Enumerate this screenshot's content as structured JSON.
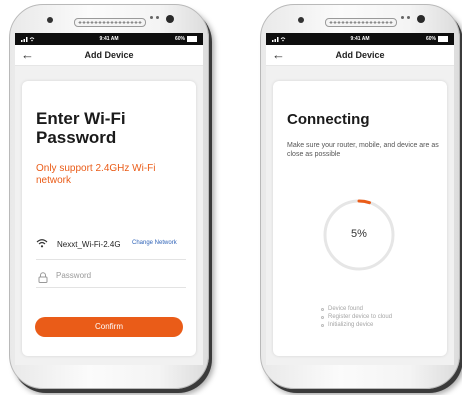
{
  "colors": {
    "accent": "#ea5c18",
    "link": "#2f63b8"
  },
  "status_bar": {
    "time": "9:41 AM",
    "battery": "60%"
  },
  "screen1": {
    "nav_title": "Add Device",
    "heading": "Enter Wi-Fi Password",
    "warning": "Only support 2.4GHz Wi-Fi network",
    "ssid": "Nexxt_Wi-Fi-2.4G",
    "change_network": "Change Network",
    "password_placeholder": "Password",
    "confirm_label": "Confirm",
    "icons": [
      "back-arrow-icon",
      "wifi-icon",
      "lock-icon"
    ]
  },
  "screen2": {
    "nav_title": "Add Device",
    "heading": "Connecting",
    "subtitle": "Make sure your router, mobile, and device are as close as possible",
    "progress_percent": 5,
    "progress_label": "5%",
    "steps": [
      "Device found",
      "Register device to cloud",
      "Initializing device"
    ]
  }
}
